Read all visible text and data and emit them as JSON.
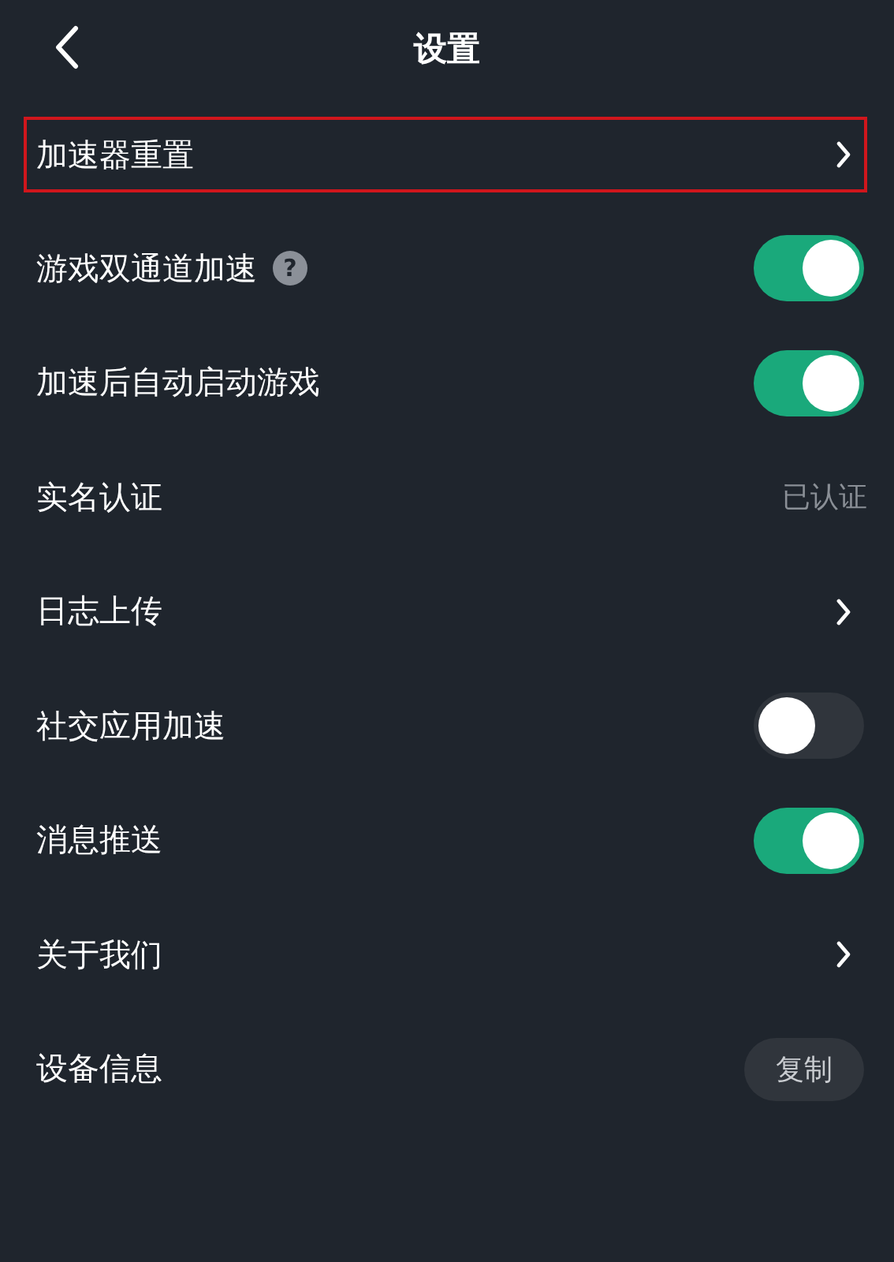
{
  "header": {
    "title": "设置"
  },
  "rows": [
    {
      "kind": "link",
      "label": "加速器重置",
      "highlighted": true
    },
    {
      "kind": "toggle",
      "label": "游戏双通道加速",
      "help": "?",
      "on": true,
      "highlighted": false
    },
    {
      "kind": "toggle",
      "label": "加速后自动启动游戏",
      "on": true,
      "highlighted": false
    },
    {
      "kind": "status",
      "label": "实名认证",
      "value": "已认证",
      "highlighted": false
    },
    {
      "kind": "link",
      "label": "日志上传",
      "highlighted": false
    },
    {
      "kind": "toggle",
      "label": "社交应用加速",
      "on": false,
      "highlighted": false
    },
    {
      "kind": "toggle",
      "label": "消息推送",
      "on": true,
      "highlighted": false
    },
    {
      "kind": "link",
      "label": "关于我们",
      "highlighted": false
    },
    {
      "kind": "button",
      "label": "设备信息",
      "button": "复制",
      "highlighted": false
    }
  ]
}
